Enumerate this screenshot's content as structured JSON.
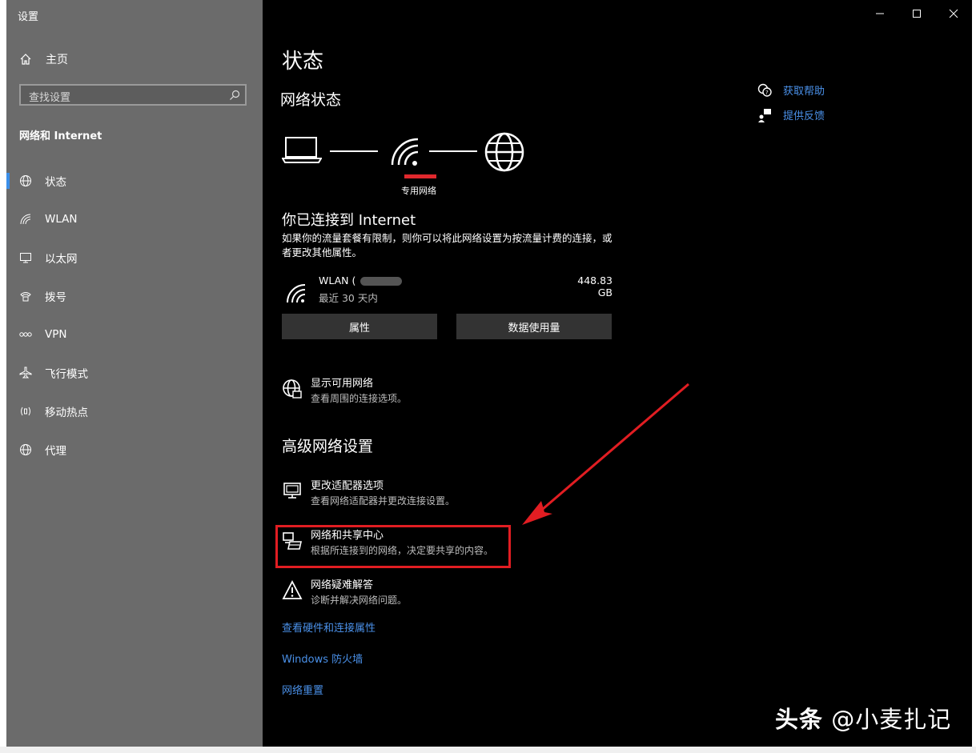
{
  "window": {
    "title": "设置"
  },
  "sidebar": {
    "home_label": "主页",
    "search_placeholder": "查找设置",
    "section_title": "网络和 Internet",
    "items": [
      {
        "label": "状态",
        "icon": "globe-icon",
        "active": true
      },
      {
        "label": "WLAN",
        "icon": "wifi-icon"
      },
      {
        "label": "以太网",
        "icon": "ethernet-icon"
      },
      {
        "label": "拨号",
        "icon": "dialup-icon"
      },
      {
        "label": "VPN",
        "icon": "vpn-icon"
      },
      {
        "label": "飞行模式",
        "icon": "airplane-icon"
      },
      {
        "label": "移动热点",
        "icon": "hotspot-icon"
      },
      {
        "label": "代理",
        "icon": "globe-icon"
      }
    ]
  },
  "main": {
    "title": "状态",
    "network_status_heading": "网络状态",
    "profile_label": "专用网络",
    "connected_title": "你已连接到 Internet",
    "connected_desc": "如果你的流量套餐有限制，则你可以将此网络设置为按流量计费的连接，或者更改其他属性。",
    "adapter": {
      "name": "WLAN (",
      "usage_period": "最近 30 天内",
      "data_used": "448.83 GB"
    },
    "buttons": {
      "properties": "属性",
      "data_usage": "数据使用量"
    },
    "show_networks": {
      "title": "显示可用网络",
      "desc": "查看周围的连接选项。"
    },
    "advanced_heading": "高级网络设置",
    "advanced_items": [
      {
        "title": "更改适配器选项",
        "desc": "查看网络适配器并更改连接设置。",
        "icon": "adapter-icon"
      },
      {
        "title": "网络和共享中心",
        "desc": "根据所连接到的网络，决定要共享的内容。",
        "icon": "sharing-center-icon"
      },
      {
        "title": "网络疑难解答",
        "desc": "诊断并解决网络问题。",
        "icon": "warning-icon"
      }
    ],
    "links": [
      "查看硬件和连接属性",
      "Windows 防火墙",
      "网络重置"
    ],
    "help": {
      "get_help": "获取帮助",
      "feedback": "提供反馈"
    }
  },
  "watermark": {
    "brand": "头条",
    "handle": "@小麦扎记"
  },
  "colors": {
    "sidebar_bg": "#6b6b6b",
    "main_bg": "#000000",
    "accent": "#4a90e8",
    "highlight_red": "#e11d22"
  }
}
